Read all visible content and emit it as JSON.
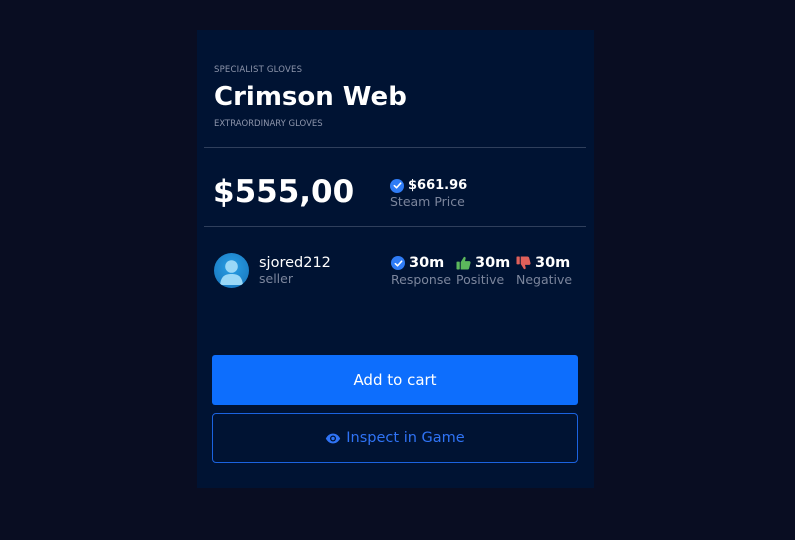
{
  "item": {
    "category": "SPECIALIST GLOVES",
    "name": "Crimson Web",
    "rarity": "EXTRAORDINARY GLOVES"
  },
  "pricing": {
    "price": "$555,00",
    "steam_price": "$661.96",
    "steam_label": "Steam Price"
  },
  "seller": {
    "name": "sjored212",
    "role": "seller",
    "avatar_icon": "user-icon"
  },
  "stats": [
    {
      "icon": "check-circle-icon",
      "value": "30m",
      "label": "Response",
      "color": "#2f7cf6"
    },
    {
      "icon": "thumbs-up-icon",
      "value": "30m",
      "label": "Positive",
      "color": "#5cb85c"
    },
    {
      "icon": "thumbs-down-icon",
      "value": "30m",
      "label": "Negative",
      "color": "#e0605a"
    }
  ],
  "actions": {
    "add_to_cart": "Add to cart",
    "inspect": "Inspect in Game",
    "inspect_icon": "eye-icon"
  },
  "colors": {
    "background": "#090d22",
    "card": "#001333",
    "primary": "#0d6efd",
    "outline": "#1b63e0",
    "muted": "#7b859c"
  }
}
